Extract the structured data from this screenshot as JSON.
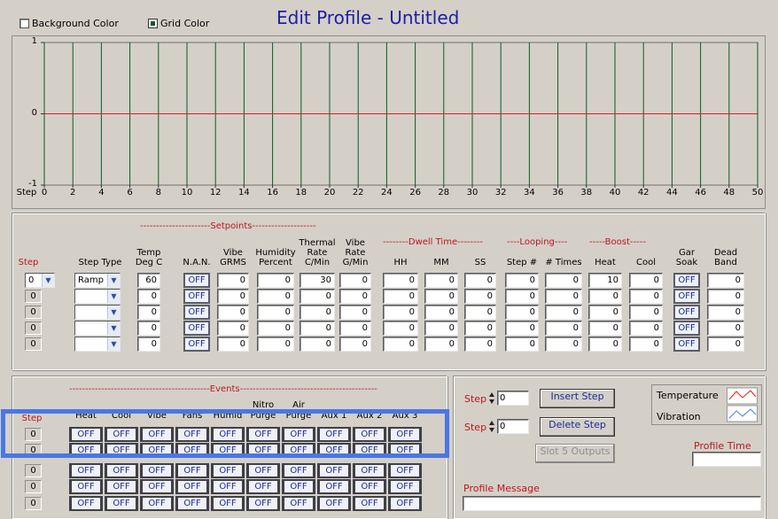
{
  "header": {
    "title": "Edit Profile - Untitled",
    "background_color_label": "Background Color",
    "grid_color_label": "Grid Color"
  },
  "chart_data": {
    "type": "line",
    "x_axis_label": "Step",
    "xlim": [
      0,
      50
    ],
    "x_ticks": [
      "0",
      "2",
      "4",
      "6",
      "8",
      "10",
      "12",
      "14",
      "16",
      "18",
      "20",
      "22",
      "24",
      "26",
      "28",
      "30",
      "32",
      "34",
      "36",
      "38",
      "40",
      "42",
      "44",
      "46",
      "48",
      "50"
    ],
    "ylim": [
      -1,
      1
    ],
    "y_ticks": [
      "1",
      "0",
      "-1"
    ],
    "grid": true,
    "grid_color": "#0b5d1e",
    "background_color": "#d4d0c8",
    "series": [
      {
        "color": "#e21b1b",
        "x": [
          0,
          50
        ],
        "y": [
          0,
          0
        ]
      }
    ]
  },
  "setpoints": {
    "group_setpoints": "----------------------Setpoints--------------------",
    "group_dwell": "--------Dwell Time--------",
    "group_looping": "----Looping----",
    "group_boost": "-----Boost-----",
    "headers": {
      "step": "Step",
      "step_type": "Step Type",
      "temp": [
        "Temp",
        "Deg C"
      ],
      "nan": "N.A.N.",
      "vibe": [
        "Vibe",
        "GRMS"
      ],
      "humidity": [
        "Humidity",
        "Percent"
      ],
      "thermal": [
        "Thermal",
        "Rate",
        "C/Min"
      ],
      "vibe_rate": [
        "Vibe",
        "Rate",
        "G/Min"
      ],
      "hh": "HH",
      "mm": "MM",
      "ss": "SS",
      "step_num": "Step #",
      "times": "# Times",
      "heat": "Heat",
      "cool": "Cool",
      "gar_soak": [
        "Gar",
        "Soak"
      ],
      "dead_band": [
        "Dead",
        "Band"
      ]
    },
    "rows": [
      {
        "step": "0",
        "type": "Ramp",
        "temp": "60",
        "nan": "OFF",
        "vibe": "0",
        "humidity": "0",
        "thermal": "30",
        "vibe_rate": "0",
        "hh": "0",
        "mm": "0",
        "ss": "0",
        "step_num": "0",
        "times": "0",
        "heat": "10",
        "cool": "0",
        "gar": "OFF",
        "dead": "0"
      },
      {
        "step": "0",
        "type": "",
        "temp": "0",
        "nan": "OFF",
        "vibe": "0",
        "humidity": "0",
        "thermal": "0",
        "vibe_rate": "0",
        "hh": "0",
        "mm": "0",
        "ss": "0",
        "step_num": "0",
        "times": "0",
        "heat": "0",
        "cool": "0",
        "gar": "OFF",
        "dead": "0"
      },
      {
        "step": "0",
        "type": "",
        "temp": "0",
        "nan": "OFF",
        "vibe": "0",
        "humidity": "0",
        "thermal": "0",
        "vibe_rate": "0",
        "hh": "0",
        "mm": "0",
        "ss": "0",
        "step_num": "0",
        "times": "0",
        "heat": "0",
        "cool": "0",
        "gar": "OFF",
        "dead": "0"
      },
      {
        "step": "0",
        "type": "",
        "temp": "0",
        "nan": "OFF",
        "vibe": "0",
        "humidity": "0",
        "thermal": "0",
        "vibe_rate": "0",
        "hh": "0",
        "mm": "0",
        "ss": "0",
        "step_num": "0",
        "times": "0",
        "heat": "0",
        "cool": "0",
        "gar": "OFF",
        "dead": "0"
      },
      {
        "step": "0",
        "type": "",
        "temp": "0",
        "nan": "OFF",
        "vibe": "0",
        "humidity": "0",
        "thermal": "0",
        "vibe_rate": "0",
        "hh": "0",
        "mm": "0",
        "ss": "0",
        "step_num": "0",
        "times": "0",
        "heat": "0",
        "cool": "0",
        "gar": "OFF",
        "dead": "0"
      }
    ]
  },
  "events": {
    "group_label": "--------------------------------------------Events-------------------------------------------",
    "step_header": "Step",
    "headers": [
      "Heat",
      "Cool",
      "Vibe",
      "Fans",
      "Humid",
      "Purge",
      "Purge",
      "Aux 1",
      "Aux 2",
      "Aux 3"
    ],
    "headers_top": [
      "",
      "",
      "",
      "",
      "",
      "Nitro",
      "Air",
      "",
      "",
      ""
    ],
    "rows": [
      {
        "step": "0",
        "values": [
          "OFF",
          "OFF",
          "OFF",
          "OFF",
          "OFF",
          "OFF",
          "OFF",
          "OFF",
          "OFF",
          "OFF"
        ]
      },
      {
        "step": "0",
        "values": [
          "OFF",
          "OFF",
          "OFF",
          "OFF",
          "OFF",
          "OFF",
          "OFF",
          "OFF",
          "OFF",
          "OFF"
        ]
      },
      {
        "step": "0",
        "values": [
          "OFF",
          "OFF",
          "OFF",
          "OFF",
          "OFF",
          "OFF",
          "OFF",
          "OFF",
          "OFF",
          "OFF"
        ]
      },
      {
        "step": "0",
        "values": [
          "OFF",
          "OFF",
          "OFF",
          "OFF",
          "OFF",
          "OFF",
          "OFF",
          "OFF",
          "OFF",
          "OFF"
        ]
      },
      {
        "step": "0",
        "values": [
          "OFF",
          "OFF",
          "OFF",
          "OFF",
          "OFF",
          "OFF",
          "OFF",
          "OFF",
          "OFF",
          "OFF"
        ]
      }
    ]
  },
  "controls": {
    "step_label_1": "Step",
    "step_value_1": "0",
    "step_label_2": "Step",
    "step_value_2": "0",
    "insert_step": "Insert Step",
    "delete_step": "Delete Step",
    "slot5_outputs": "Slot 5 Outputs",
    "legend_temperature": "Temperature",
    "legend_vibration": "Vibration",
    "temperature_color": "#e21b1b",
    "vibration_color": "#3b7fe0",
    "profile_time_label": "Profile Time",
    "profile_time_value": "",
    "profile_message_label": "Profile Message",
    "profile_message_value": ""
  }
}
